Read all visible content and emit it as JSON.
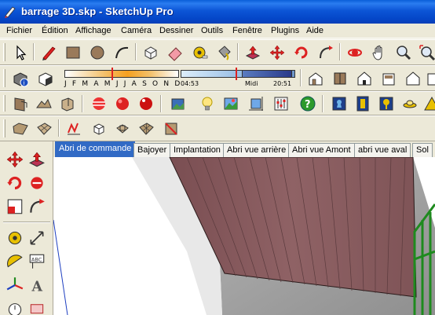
{
  "window": {
    "title": "barrage 3D.skp - SketchUp Pro"
  },
  "menu": [
    "Fichier",
    "Édition",
    "Affichage",
    "Caméra",
    "Dessiner",
    "Outils",
    "Fenêtre",
    "Plugins",
    "Aide"
  ],
  "shadows": {
    "months": "J F M A M J J A S O N D",
    "time_start": "04:53",
    "time_mid": "Midi",
    "time_end": "20:51"
  },
  "scene_tabs": [
    {
      "label": "Abri de commande",
      "active": true
    },
    {
      "label": "Bajoyer",
      "active": false
    },
    {
      "label": "Implantation",
      "active": false
    },
    {
      "label": "Abri vue arrière",
      "active": false
    },
    {
      "label": "Abri vue Amont",
      "active": false
    },
    {
      "label": "abri vue aval",
      "active": false
    },
    {
      "label": "Sol",
      "active": false
    }
  ],
  "colors": {
    "titlebar": "#0a55d6",
    "active_tab": "#316ac5",
    "wall": "#8a5a5e",
    "railing": "#1e8a1e"
  }
}
